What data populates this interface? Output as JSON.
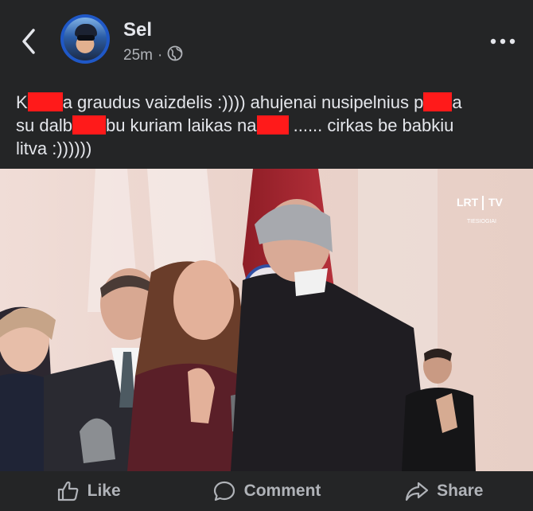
{
  "post": {
    "author": "Sel",
    "time": "25m",
    "separator": "·",
    "privacy_icon": "globe-icon",
    "text": {
      "l1a": "K",
      "l1b": "a graudus vaizdelis :)))) ahujenai nusipelnius p",
      "l1c": "a",
      "l2a": "su dalb",
      "l2b": "bu kuriam laikas na",
      "l2c": " ...... cirkas be babkiu",
      "l3": "litva :))))))"
    }
  },
  "image": {
    "channel_logo": "LRT",
    "channel_suffix": "TV",
    "live_label": "TIESIOGIAI"
  },
  "actions": {
    "like": "Like",
    "comment": "Comment",
    "share": "Share"
  },
  "colors": {
    "background": "#242526",
    "text": "#e4e6eb",
    "muted": "#b0b3b8",
    "redaction": "#ff1a1a",
    "avatar_ring": "#1f58c7"
  }
}
